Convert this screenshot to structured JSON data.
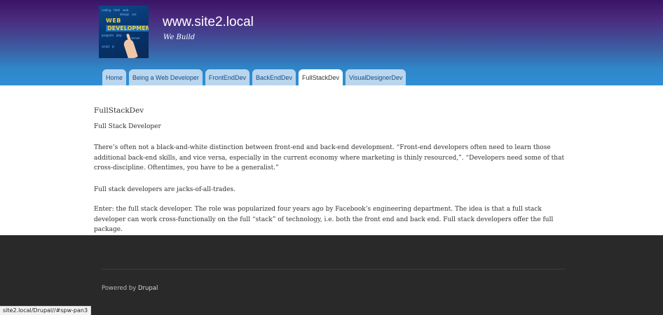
{
  "header": {
    "site_name": "www.site2.local",
    "slogan": "We Build",
    "logo": {
      "line1": "WEB",
      "line2": "DEVELOPMENT"
    }
  },
  "tabs": [
    {
      "label": "Home",
      "active": false
    },
    {
      "label": "Being a Web Developer",
      "active": false
    },
    {
      "label": "FrontEndDev",
      "active": false
    },
    {
      "label": "BackEndDev",
      "active": false
    },
    {
      "label": "FullStackDev",
      "active": true
    },
    {
      "label": "VisualDesignerDev",
      "active": false
    }
  ],
  "content": {
    "page_title": "FullStackDev",
    "subtitle": "Full Stack Developer",
    "paragraphs": [
      "There’s often not a black-and-white distinction between front-end and back-end development. “Front-end developers often need to learn those additional back-end skills, and vice versa, especially in the current economy where marketing is thinly resourced,”. “Developers need some of that cross-discipline. Oftentimes, you have to be a generalist.”",
      "Full stack developers are jacks-of-all-trades.",
      "Enter: the full stack developer. The role was popularized four years ago by Facebook’s engineering department. The idea is that a full stack developer can work cross-functionally on the full “stack” of technology, i.e. both the front end and back end. Full stack developers offer the full package."
    ]
  },
  "footer": {
    "powered_prefix": "Powered by ",
    "powered_link": "Drupal"
  },
  "status_bar": {
    "url": "site2.local/Drupal//#spw-pan3"
  },
  "colors": {
    "header_top": "#3a1466",
    "header_bottom": "#2f8fd6",
    "tab_bg": "#b9d6ee",
    "tab_text": "#1a4c86",
    "footer_bg": "#292929"
  }
}
